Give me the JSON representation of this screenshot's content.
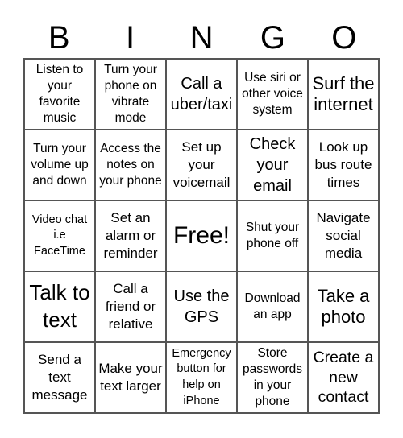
{
  "header": {
    "letters": [
      "B",
      "I",
      "N",
      "G",
      "O"
    ]
  },
  "cells": [
    "Listen to your favorite music",
    "Turn your phone on vibrate mode",
    "Call a uber/taxi",
    "Use siri or other voice system",
    "Surf the internet",
    "Turn your volume up and down",
    "Access the notes on your phone",
    "Set up your voicemail",
    "Check your email",
    "Look up bus route times",
    "Video chat i.e FaceTime",
    "Set an alarm or reminder",
    "Free!",
    "Shut your phone off",
    "Navigate social media",
    "Talk to text",
    "Call a friend or relative",
    "Use the GPS",
    "Download an app",
    "Take a photo",
    "Send a text message",
    "Make your text larger",
    "Emergency button for help on iPhone",
    "Store passwords in your phone",
    "Create a new contact"
  ]
}
